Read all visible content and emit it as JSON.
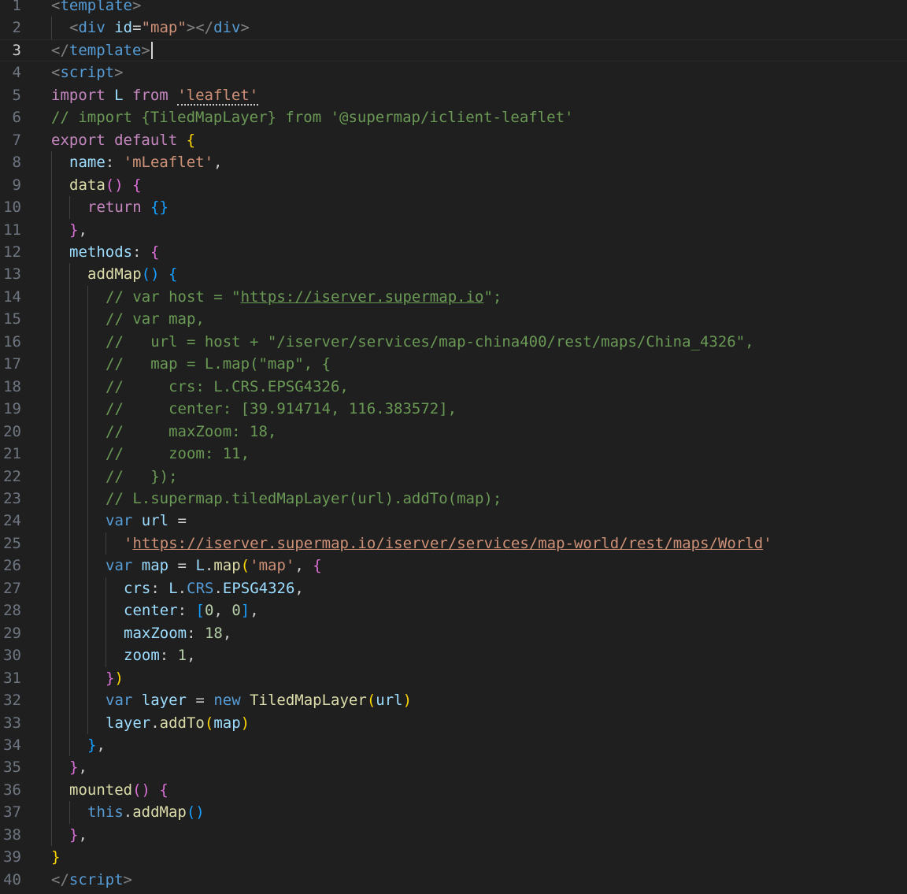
{
  "editor": {
    "cursor_line": 3,
    "colors": {
      "background": "#1f1f1f",
      "line_number": "#6e7681",
      "tag": "#808080",
      "tag_name": "#569cd6",
      "attr": "#9cdcfe",
      "string": "#ce9178",
      "comment": "#6a9955",
      "keyword_control": "#c586c0",
      "keyword": "#569cd6",
      "function": "#dcdcaa",
      "variable": "#9cdcfe",
      "type": "#4ec9b0",
      "number": "#b5cea8",
      "bracket1": "#ffd700",
      "bracket2": "#da70d6",
      "bracket3": "#179fff",
      "text": "#cccccc"
    },
    "lines": [
      {
        "n": "1",
        "indent": 0,
        "tokens": [
          [
            "<",
            "tag"
          ],
          [
            "template",
            "tag_name"
          ],
          [
            ">",
            "tag"
          ]
        ]
      },
      {
        "n": "2",
        "indent": 1,
        "tokens": [
          [
            "<",
            "tag"
          ],
          [
            "div",
            "tag_name"
          ],
          [
            " ",
            "text"
          ],
          [
            "id",
            "attr"
          ],
          [
            "=",
            "text"
          ],
          [
            "\"map\"",
            "string"
          ],
          [
            "></",
            "tag"
          ],
          [
            "div",
            "tag_name"
          ],
          [
            ">",
            "tag"
          ]
        ]
      },
      {
        "n": "3",
        "indent": 0,
        "tokens": [
          [
            "</",
            "tag"
          ],
          [
            "template",
            "tag_name"
          ],
          [
            ">",
            "tag"
          ]
        ],
        "cursor": true
      },
      {
        "n": "4",
        "indent": 0,
        "tokens": [
          [
            "<",
            "tag"
          ],
          [
            "script",
            "tag_name"
          ],
          [
            ">",
            "tag"
          ]
        ]
      },
      {
        "n": "5",
        "indent": 0,
        "tokens": [
          [
            "import",
            "keyword_control"
          ],
          [
            " L ",
            "variable"
          ],
          [
            "from",
            "keyword_control"
          ],
          [
            " ",
            "text"
          ],
          [
            "'leaflet'",
            "string_dots"
          ]
        ]
      },
      {
        "n": "6",
        "indent": 0,
        "tokens": [
          [
            "// import {TiledMapLayer} from '@supermap/iclient-leaflet'",
            "comment"
          ]
        ]
      },
      {
        "n": "7",
        "indent": 0,
        "tokens": [
          [
            "export",
            "keyword_control"
          ],
          [
            " ",
            "text"
          ],
          [
            "default",
            "keyword_control"
          ],
          [
            " ",
            "text"
          ],
          [
            "{",
            "bracket1"
          ]
        ]
      },
      {
        "n": "8",
        "indent": 1,
        "tokens": [
          [
            "name",
            "variable"
          ],
          [
            ": ",
            "text"
          ],
          [
            "'mLeaflet'",
            "string"
          ],
          [
            ",",
            "text"
          ]
        ]
      },
      {
        "n": "9",
        "indent": 1,
        "tokens": [
          [
            "data",
            "function"
          ],
          [
            "()",
            "bracket2"
          ],
          [
            " ",
            "text"
          ],
          [
            "{",
            "bracket2"
          ]
        ]
      },
      {
        "n": "10",
        "indent": 2,
        "tokens": [
          [
            "return",
            "keyword_control"
          ],
          [
            " ",
            "text"
          ],
          [
            "{}",
            "bracket3"
          ]
        ]
      },
      {
        "n": "11",
        "indent": 1,
        "tokens": [
          [
            "}",
            "bracket2"
          ],
          [
            ",",
            "text"
          ]
        ]
      },
      {
        "n": "12",
        "indent": 1,
        "tokens": [
          [
            "methods",
            "variable"
          ],
          [
            ": ",
            "text"
          ],
          [
            "{",
            "bracket2"
          ]
        ]
      },
      {
        "n": "13",
        "indent": 2,
        "tokens": [
          [
            "addMap",
            "function"
          ],
          [
            "()",
            "bracket3"
          ],
          [
            " ",
            "text"
          ],
          [
            "{",
            "bracket3"
          ]
        ]
      },
      {
        "n": "14",
        "indent": 3,
        "tokens": [
          [
            "// var host = \"",
            "comment"
          ],
          [
            "https://iserver.supermap.io",
            "comment_ul"
          ],
          [
            "\";",
            "comment"
          ]
        ]
      },
      {
        "n": "15",
        "indent": 3,
        "tokens": [
          [
            "// var map,",
            "comment"
          ]
        ]
      },
      {
        "n": "16",
        "indent": 3,
        "tokens": [
          [
            "//   url = host + \"/iserver/services/map-china400/rest/maps/China_4326\",",
            "comment"
          ]
        ]
      },
      {
        "n": "17",
        "indent": 3,
        "tokens": [
          [
            "//   map = L.map(\"map\", {",
            "comment"
          ]
        ]
      },
      {
        "n": "18",
        "indent": 3,
        "tokens": [
          [
            "//     crs: L.CRS.EPSG4326,",
            "comment"
          ]
        ]
      },
      {
        "n": "19",
        "indent": 3,
        "tokens": [
          [
            "//     center: [39.914714, 116.383572],",
            "comment"
          ]
        ]
      },
      {
        "n": "20",
        "indent": 3,
        "tokens": [
          [
            "//     maxZoom: 18,",
            "comment"
          ]
        ]
      },
      {
        "n": "21",
        "indent": 3,
        "tokens": [
          [
            "//     zoom: 11,",
            "comment"
          ]
        ]
      },
      {
        "n": "22",
        "indent": 3,
        "tokens": [
          [
            "//   });",
            "comment"
          ]
        ]
      },
      {
        "n": "23",
        "indent": 3,
        "tokens": [
          [
            "// L.supermap.tiledMapLayer(url).addTo(map);",
            "comment"
          ]
        ]
      },
      {
        "n": "24",
        "indent": 3,
        "tokens": [
          [
            "var",
            "keyword"
          ],
          [
            " ",
            "text"
          ],
          [
            "url",
            "variable"
          ],
          [
            " =",
            "text"
          ]
        ]
      },
      {
        "n": "25",
        "indent": 4,
        "tokens": [
          [
            "'",
            "string"
          ],
          [
            "https://iserver.supermap.io/iserver/services/map-world/rest/maps/World",
            "string_ul"
          ],
          [
            "'",
            "string"
          ]
        ]
      },
      {
        "n": "26",
        "indent": 3,
        "tokens": [
          [
            "var",
            "keyword"
          ],
          [
            " ",
            "text"
          ],
          [
            "map",
            "variable"
          ],
          [
            " = ",
            "text"
          ],
          [
            "L",
            "variable"
          ],
          [
            ".",
            "text"
          ],
          [
            "map",
            "function"
          ],
          [
            "(",
            "bracket1"
          ],
          [
            "'map'",
            "string"
          ],
          [
            ", ",
            "text"
          ],
          [
            "{",
            "bracket2"
          ]
        ]
      },
      {
        "n": "27",
        "indent": 4,
        "tokens": [
          [
            "crs",
            "variable"
          ],
          [
            ": ",
            "text"
          ],
          [
            "L",
            "variable"
          ],
          [
            ".",
            "text"
          ],
          [
            "CRS",
            "keyword"
          ],
          [
            ".",
            "text"
          ],
          [
            "EPSG4326",
            "variable"
          ],
          [
            ",",
            "text"
          ]
        ]
      },
      {
        "n": "28",
        "indent": 4,
        "tokens": [
          [
            "center",
            "variable"
          ],
          [
            ": ",
            "text"
          ],
          [
            "[",
            "bracket3"
          ],
          [
            "0",
            "number"
          ],
          [
            ", ",
            "text"
          ],
          [
            "0",
            "number"
          ],
          [
            "]",
            "bracket3"
          ],
          [
            ",",
            "text"
          ]
        ]
      },
      {
        "n": "29",
        "indent": 4,
        "tokens": [
          [
            "maxZoom",
            "variable"
          ],
          [
            ": ",
            "text"
          ],
          [
            "18",
            "number"
          ],
          [
            ",",
            "text"
          ]
        ]
      },
      {
        "n": "30",
        "indent": 4,
        "tokens": [
          [
            "zoom",
            "variable"
          ],
          [
            ": ",
            "text"
          ],
          [
            "1",
            "number"
          ],
          [
            ",",
            "text"
          ]
        ]
      },
      {
        "n": "31",
        "indent": 3,
        "tokens": [
          [
            "}",
            "bracket2"
          ],
          [
            ")",
            "bracket1"
          ]
        ]
      },
      {
        "n": "32",
        "indent": 3,
        "tokens": [
          [
            "var",
            "keyword"
          ],
          [
            " ",
            "text"
          ],
          [
            "layer",
            "variable"
          ],
          [
            " = ",
            "text"
          ],
          [
            "new",
            "keyword"
          ],
          [
            " ",
            "text"
          ],
          [
            "TiledMapLayer",
            "function"
          ],
          [
            "(",
            "bracket1"
          ],
          [
            "url",
            "variable"
          ],
          [
            ")",
            "bracket1"
          ]
        ]
      },
      {
        "n": "33",
        "indent": 3,
        "tokens": [
          [
            "layer",
            "variable"
          ],
          [
            ".",
            "text"
          ],
          [
            "addTo",
            "function"
          ],
          [
            "(",
            "bracket1"
          ],
          [
            "map",
            "variable"
          ],
          [
            ")",
            "bracket1"
          ]
        ]
      },
      {
        "n": "34",
        "indent": 2,
        "tokens": [
          [
            "}",
            "bracket3"
          ],
          [
            ",",
            "text"
          ]
        ]
      },
      {
        "n": "35",
        "indent": 1,
        "tokens": [
          [
            "}",
            "bracket2"
          ],
          [
            ",",
            "text"
          ]
        ]
      },
      {
        "n": "36",
        "indent": 1,
        "tokens": [
          [
            "mounted",
            "function"
          ],
          [
            "()",
            "bracket2"
          ],
          [
            " ",
            "text"
          ],
          [
            "{",
            "bracket2"
          ]
        ]
      },
      {
        "n": "37",
        "indent": 2,
        "tokens": [
          [
            "this",
            "keyword"
          ],
          [
            ".",
            "text"
          ],
          [
            "addMap",
            "function"
          ],
          [
            "()",
            "bracket3"
          ]
        ]
      },
      {
        "n": "38",
        "indent": 1,
        "tokens": [
          [
            "}",
            "bracket2"
          ],
          [
            ",",
            "text"
          ]
        ]
      },
      {
        "n": "39",
        "indent": 0,
        "tokens": [
          [
            "}",
            "bracket1"
          ]
        ]
      },
      {
        "n": "40",
        "indent": 0,
        "tokens": [
          [
            "</",
            "tag"
          ],
          [
            "script",
            "tag_name"
          ],
          [
            ">",
            "tag"
          ]
        ]
      }
    ]
  }
}
